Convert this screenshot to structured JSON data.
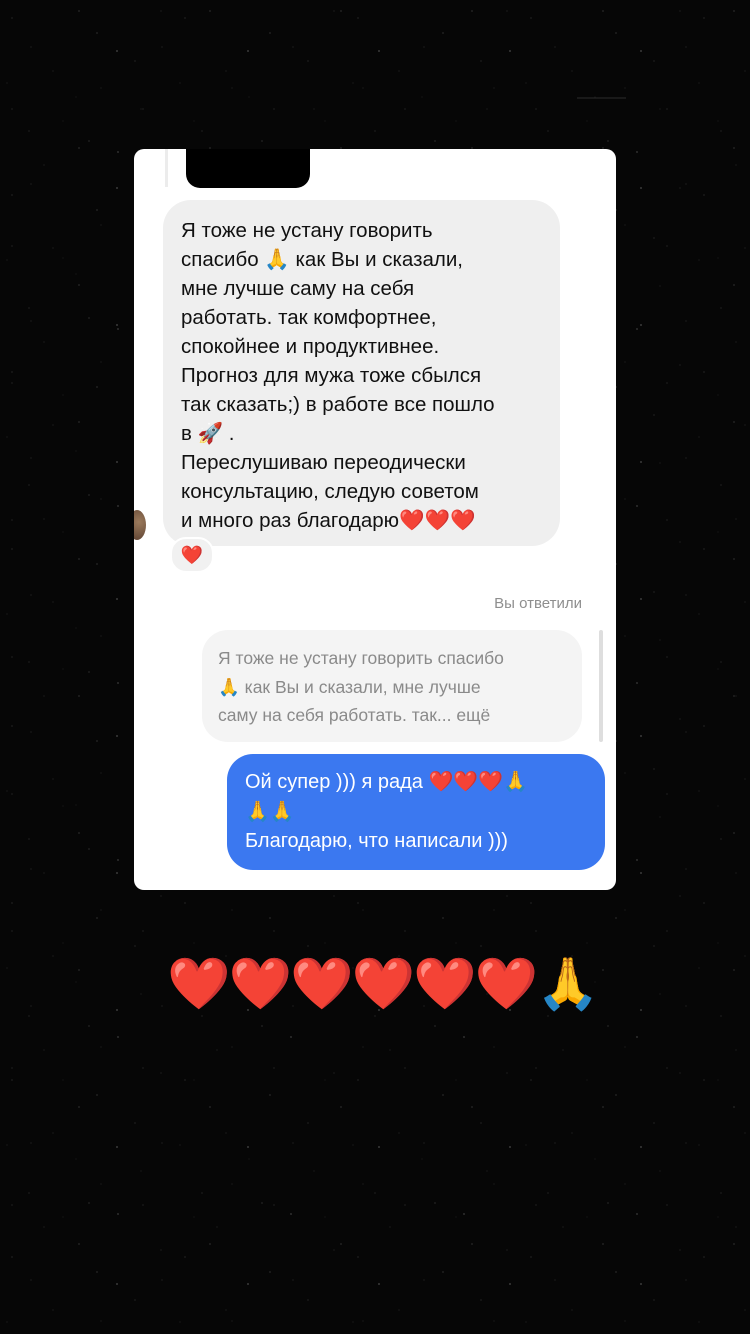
{
  "incoming_message": {
    "lines": [
      "Я тоже не устану говорить",
      "спасибо 🙏 как Вы и сказали,",
      "мне лучше саму на себя",
      "работать.  так комфортнее,",
      "спокойнее и продуктивнее.",
      "Прогноз для мужа тоже сбылся",
      "так сказать;) в работе все пошло",
      "в 🚀 .",
      "Переслушиваю переодически",
      "консультацию, следую советом",
      "и много раз благодарю❤️❤️❤️"
    ],
    "reaction": "❤️"
  },
  "reply_section": {
    "label": "Вы ответили",
    "quote_lines": [
      "Я тоже не устану говорить спасибо",
      "🙏 как Вы и сказали, мне лучше",
      "саму на себя работать.  так... ещё"
    ]
  },
  "outgoing_message": {
    "lines": [
      "Ой супер ))) я рада ❤️❤️❤️🙏",
      "🙏🙏",
      "Благодарю, что написали )))"
    ]
  },
  "overlay_text": "❤️❤️❤️❤️❤️❤️🙏",
  "colors": {
    "background": "#060606",
    "card": "#ffffff",
    "incoming_bubble": "#efefef",
    "outgoing_bubble": "#3b78f0",
    "muted_text": "#8e8e8e"
  }
}
